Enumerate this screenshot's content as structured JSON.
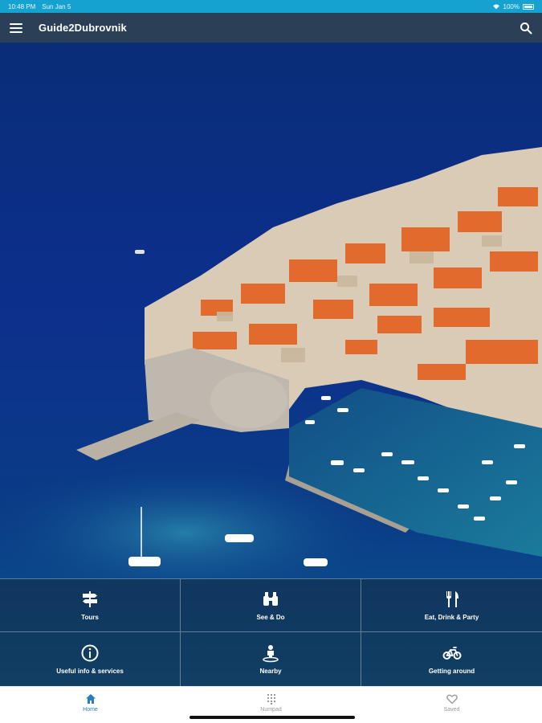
{
  "status_bar": {
    "time": "10:48 PM",
    "date": "Sun Jan 5",
    "battery": "100%",
    "icons": [
      "wifi-icon",
      "battery-icon"
    ]
  },
  "app_bar": {
    "title": "Guide2Dubrovnik",
    "icons": [
      "menu-icon",
      "search-icon"
    ]
  },
  "tiles": [
    {
      "label": "Tours",
      "icon": "signpost-icon"
    },
    {
      "label": "See & Do",
      "icon": "binoculars-icon"
    },
    {
      "label": "Eat, Drink & Party",
      "icon": "fork-knife-icon"
    },
    {
      "label": "Useful info & services",
      "icon": "info-icon"
    },
    {
      "label": "Nearby",
      "icon": "person-pin-icon"
    },
    {
      "label": "Getting around",
      "icon": "bicycle-icon"
    }
  ],
  "bottom_nav": [
    {
      "label": "Home",
      "icon": "home-icon",
      "active": true
    },
    {
      "label": "Numpad",
      "icon": "numpad-icon",
      "active": false
    },
    {
      "label": "Saved",
      "icon": "heart-icon",
      "active": false
    }
  ],
  "colors": {
    "status_bar": "#16a2d0",
    "app_bar": "#2b3f57",
    "active_nav": "#2a7fc4",
    "sea": "#0b2f7a"
  }
}
